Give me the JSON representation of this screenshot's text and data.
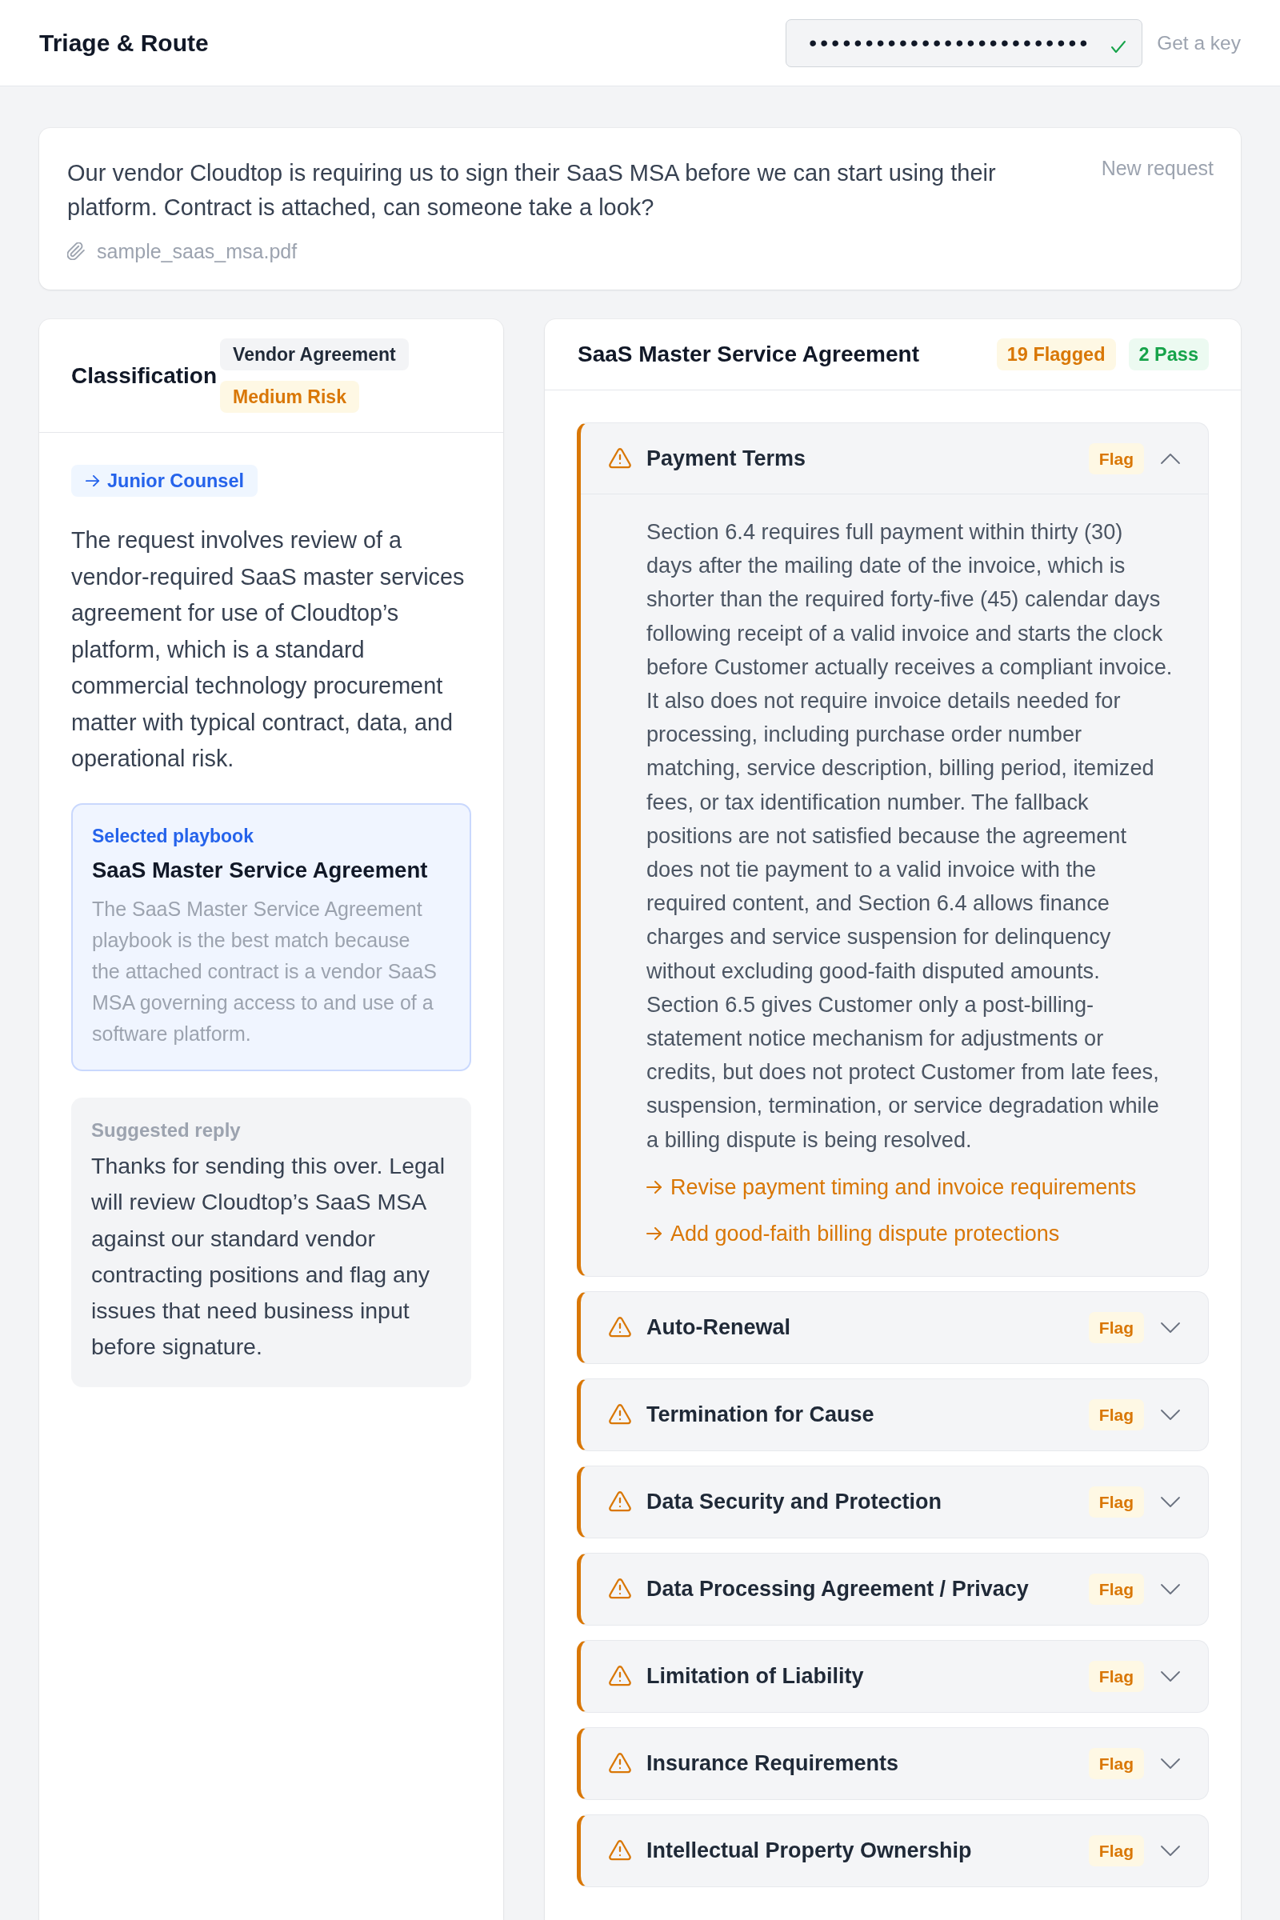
{
  "header": {
    "title": "Triage & Route",
    "api_key": {
      "masked_value": "•••••••••••••••••••••••••",
      "valid": true
    },
    "key_link": "Get a key"
  },
  "request": {
    "message": "Our vendor Cloudtop is requiring us to sign their SaaS MSA before we can start using their platform. Contract is attached, can someone take a look?",
    "status": "New request",
    "attachment": "sample_saas_msa.pdf"
  },
  "classification": {
    "title": "Classification",
    "badges": [
      {
        "label": "Vendor Agreement",
        "kind": "category"
      },
      {
        "label": "Medium Risk",
        "kind": "risk"
      }
    ],
    "route": "Junior Counsel",
    "summary": "The request involves review of a vendor-required SaaS master services agreement for use of Cloudtop’s platform, which is a standard commercial technology procurement matter with typical contract, data, and operational risk.",
    "playbook": {
      "label": "Selected playbook",
      "title": "SaaS Master Service Agreement",
      "reason": "The SaaS Master Service Agreement playbook is the best match because the attached contract is a vendor SaaS MSA governing access to and use of a software platform."
    },
    "suggested_reply": {
      "label": "Suggested reply",
      "text": "Thanks for sending this over. Legal will review Cloudtop’s SaaS MSA against our standard vendor contracting positions and flag any issues that need business input before signature."
    }
  },
  "review": {
    "title": "SaaS Master Service Agreement",
    "counts": [
      {
        "label": "19 Flagged",
        "kind": "flag"
      },
      {
        "label": "2 Pass",
        "kind": "pass"
      }
    ],
    "clauses": [
      {
        "title": "Payment Terms",
        "kind": "flag",
        "badge": "Flag",
        "expanded": true,
        "detail": "Section 6.4 requires full payment within thirty (30) days after the mailing date of the invoice, which is shorter than the required forty-five (45) calendar days following receipt of a valid invoice and starts the clock before Customer actually receives a compliant invoice. It also does not require invoice details needed for processing, including purchase order number matching, service description, billing period, itemized fees, or tax identification number. The fallback positions are not satisfied because the agreement does not tie payment to a valid invoice with the required content, and Section 6.4 allows finance charges and service suspension for delinquency without excluding good-faith disputed amounts. Section 6.5 gives Customer only a post-billing-statement notice mechanism for adjustments or credits, but does not protect Customer from late fees, suspension, termination, or service degradation while a billing dispute is being resolved.",
        "actions": [
          "Revise payment timing and invoice requirements",
          "Add good-faith billing dispute protections"
        ]
      },
      {
        "title": "Auto-Renewal",
        "kind": "flag",
        "badge": "Flag",
        "expanded": false
      },
      {
        "title": "Termination for Cause",
        "kind": "flag",
        "badge": "Flag",
        "expanded": false
      },
      {
        "title": "Data Security and Protection",
        "kind": "flag",
        "badge": "Flag",
        "expanded": false
      },
      {
        "title": "Data Processing Agreement / Privacy",
        "kind": "flag",
        "badge": "Flag",
        "expanded": false
      },
      {
        "title": "Limitation of Liability",
        "kind": "flag",
        "badge": "Flag",
        "expanded": false
      },
      {
        "title": "Insurance Requirements",
        "kind": "flag",
        "badge": "Flag",
        "expanded": false
      },
      {
        "title": "Intellectual Property Ownership",
        "kind": "flag",
        "badge": "Flag",
        "expanded": false
      }
    ]
  }
}
